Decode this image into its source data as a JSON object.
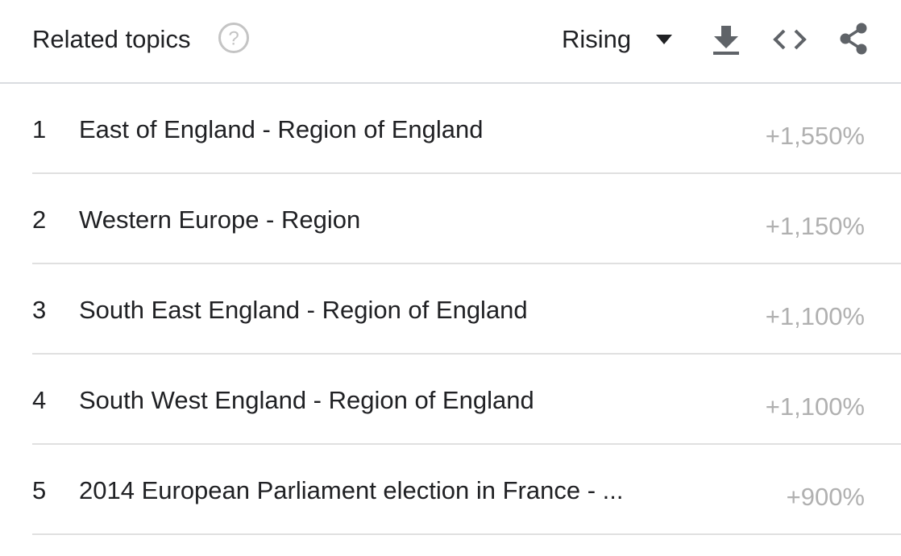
{
  "header": {
    "title": "Related topics",
    "help_icon": "help-circle-icon",
    "sort": {
      "selected": "Rising"
    },
    "actions": [
      {
        "name": "download",
        "icon": "download-icon"
      },
      {
        "name": "embed",
        "icon": "code-icon"
      },
      {
        "name": "share",
        "icon": "share-icon"
      }
    ]
  },
  "items": [
    {
      "rank": "1",
      "topic": "East of England - Region of England",
      "value": "+1,550%"
    },
    {
      "rank": "2",
      "topic": "Western Europe - Region",
      "value": "+1,150%"
    },
    {
      "rank": "3",
      "topic": "South East England - Region of England",
      "value": "+1,100%"
    },
    {
      "rank": "4",
      "topic": "South West England - Region of England",
      "value": "+1,100%"
    },
    {
      "rank": "5",
      "topic": "2014 European Parliament election in France - ...",
      "value": "+900%"
    }
  ],
  "colors": {
    "text": "#202124",
    "icon": "#5f6368",
    "value": "#b0b0b0",
    "divider": "#dadce0"
  }
}
